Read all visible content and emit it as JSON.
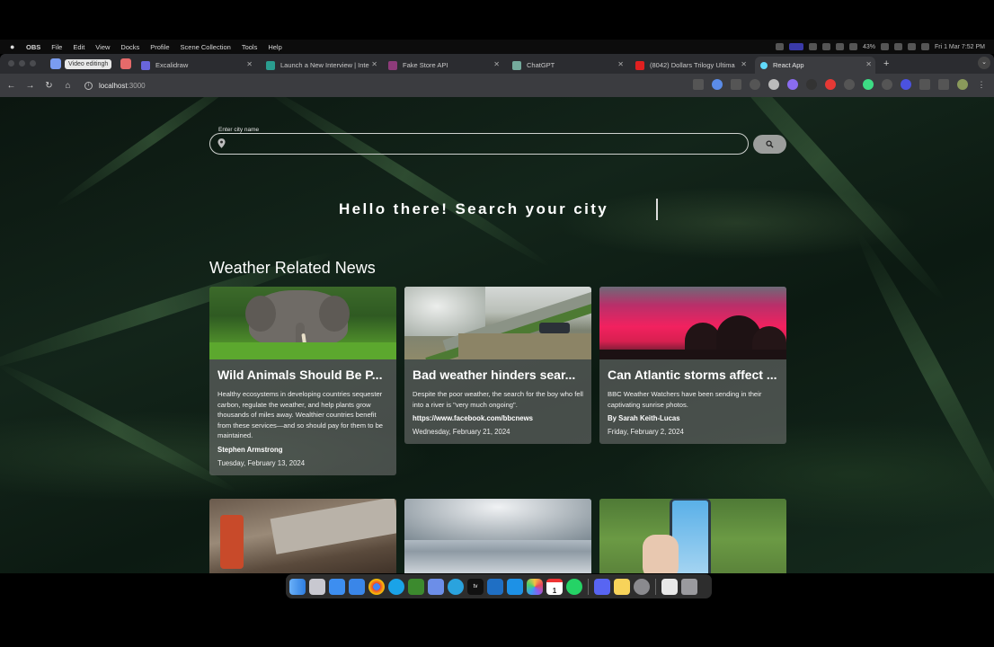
{
  "menubar": {
    "app_name": "OBS",
    "items": [
      "File",
      "Edit",
      "View",
      "Docks",
      "Profile",
      "Scene Collection",
      "Tools",
      "Help"
    ],
    "battery": "43%",
    "clock": "Fri 1 Mar  7:52 PM"
  },
  "browser": {
    "tab_group_label": "Video editingh",
    "tabs": [
      {
        "title": "Excalidraw",
        "color": "#6965db"
      },
      {
        "title": "Launch a New Interview | Inte",
        "color": "#2a9d8f"
      },
      {
        "title": "Fake Store API",
        "color": "#8e3b7a"
      },
      {
        "title": "ChatGPT",
        "color": "#74aa9c"
      },
      {
        "title": "(8042) Dollars Trilogy Ultima",
        "color": "#e02020"
      },
      {
        "title": "React App",
        "color": "#61dafb"
      }
    ],
    "url_host": "localhost",
    "url_port": ":3000"
  },
  "search": {
    "label": "Enter city name",
    "value": "",
    "placeholder": ""
  },
  "hero": {
    "text": "Hello there! Search your city"
  },
  "news": {
    "heading": "Weather Related News",
    "cards": [
      {
        "title": "Wild Animals Should Be P...",
        "description": "Healthy ecosystems in developing countries sequester carbon, regulate the weather, and help plants grow thousands of miles away. Wealthier countries benefit from these services—and so should pay for them to be maintained.",
        "author": "Stephen Armstrong",
        "date": "Tuesday, February 13, 2024"
      },
      {
        "title": "Bad weather hinders sear...",
        "description": "Despite the poor weather, the search for the boy who fell into a river is \"very much ongoing\".",
        "author": "https://www.facebook.com/bbcnews",
        "date": "Wednesday, February 21, 2024"
      },
      {
        "title": "Can Atlantic storms affect ...",
        "description": "BBC Weather Watchers have been sending in their captivating sunrise photos.",
        "author": "By Sarah Keith-Lucas",
        "date": "Friday, February 2, 2024"
      }
    ]
  },
  "dock": {
    "apps": [
      "finder",
      "launchpad",
      "safari",
      "mail",
      "chrome",
      "skype",
      "minecraft",
      "vpn",
      "telegram",
      "apple-tv",
      "vscode",
      "docker",
      "photos",
      "calendar",
      "whatsapp",
      "discord",
      "notes",
      "system-settings",
      "preview",
      "trash"
    ],
    "calendar_day": "1"
  }
}
